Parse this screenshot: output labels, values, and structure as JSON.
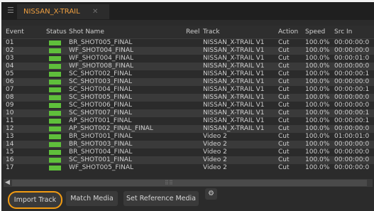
{
  "tab": {
    "title": "NISSAN_X-TRAIL",
    "close": "✕",
    "menu": "☰"
  },
  "columns": [
    "Event",
    "Status",
    "Shot Name",
    "Reel",
    "Track",
    "Action",
    "Speed",
    "Src In"
  ],
  "rows": [
    {
      "event": "01",
      "shot": "BR_SHOT005_FINAL",
      "reel": "",
      "track": "NISSAN_X-TRAIL V1",
      "action": "Cut",
      "speed": "100.0%",
      "src_in": "00:00:00:0"
    },
    {
      "event": "02",
      "shot": "WF_SHOT004_FINAL",
      "reel": "",
      "track": "NISSAN_X-TRAIL V1",
      "action": "Cut",
      "speed": "100.0%",
      "src_in": "00:00:00:0"
    },
    {
      "event": "03",
      "shot": "WF_SHOT004_FINAL",
      "reel": "",
      "track": "NISSAN_X-TRAIL V1",
      "action": "Cut",
      "speed": "100.0%",
      "src_in": "00:00:01:0"
    },
    {
      "event": "04",
      "shot": "WF_SHOT008_FINAL",
      "reel": "",
      "track": "NISSAN_X-TRAIL V1",
      "action": "Cut",
      "speed": "100.0%",
      "src_in": "00:00:00:0"
    },
    {
      "event": "05",
      "shot": "SC_SHOT002_FINAL",
      "reel": "",
      "track": "NISSAN_X-TRAIL V1",
      "action": "Cut",
      "speed": "100.0%",
      "src_in": "00:00:00:1"
    },
    {
      "event": "06",
      "shot": "SC_SHOT003_FINAL",
      "reel": "",
      "track": "NISSAN_X-TRAIL V1",
      "action": "Cut",
      "speed": "100.0%",
      "src_in": "00:00:00:0"
    },
    {
      "event": "07",
      "shot": "SC_SHOT004_FINAL",
      "reel": "",
      "track": "NISSAN_X-TRAIL V1",
      "action": "Cut",
      "speed": "100.0%",
      "src_in": "00:00:00:1"
    },
    {
      "event": "08",
      "shot": "SC_SHOT005_FINAL",
      "reel": "",
      "track": "NISSAN_X-TRAIL V1",
      "action": "Cut",
      "speed": "100.0%",
      "src_in": "00:00:00:0"
    },
    {
      "event": "09",
      "shot": "SC_SHOT006_FINAL",
      "reel": "",
      "track": "NISSAN_X-TRAIL V1",
      "action": "Cut",
      "speed": "100.0%",
      "src_in": "00:00:00:0"
    },
    {
      "event": "10",
      "shot": "SC_SHOT007_FINAL",
      "reel": "",
      "track": "NISSAN_X-TRAIL V1",
      "action": "Cut",
      "speed": "100.0%",
      "src_in": "00:00:00:1"
    },
    {
      "event": "11",
      "shot": "AP_SHOT001_FINAL",
      "reel": "",
      "track": "NISSAN_X-TRAIL V1",
      "action": "Cut",
      "speed": "100.0%",
      "src_in": "00:00:00:1"
    },
    {
      "event": "12",
      "shot": "AP_SHOT002_FINAL_FINAL",
      "reel": "",
      "track": "NISSAN_X-TRAIL V1",
      "action": "Cut",
      "speed": "100.0%",
      "src_in": "00:00:00:0"
    },
    {
      "event": "13",
      "shot": "BR_SHOT001_FINAL",
      "reel": "",
      "track": "Video 2",
      "action": "Cut",
      "speed": "100.0%",
      "src_in": "01:00:01:0"
    },
    {
      "event": "14",
      "shot": "BR_SHOT003_FINAL",
      "reel": "",
      "track": "Video 2",
      "action": "Cut",
      "speed": "100.0%",
      "src_in": "00:00:00:0"
    },
    {
      "event": "15",
      "shot": "BR_SHOT004_FINAL",
      "reel": "",
      "track": "Video 2",
      "action": "Cut",
      "speed": "100.0%",
      "src_in": "00:00:00:0"
    },
    {
      "event": "16",
      "shot": "SC_SHOT001_FINAL",
      "reel": "",
      "track": "Video 2",
      "action": "Cut",
      "speed": "100.0%",
      "src_in": "00:00:00:0"
    },
    {
      "event": "17",
      "shot": "WF_SHOT005_FINAL",
      "reel": "",
      "track": "Video 2",
      "action": "Cut",
      "speed": "100.0%",
      "src_in": "00:00:00:0"
    }
  ],
  "scrollbar": {
    "arrow": "◀",
    "grip": "⠿⠿"
  },
  "buttons": {
    "import": "Import Track",
    "match": "Match Media",
    "set_ref": "Set Reference Media",
    "gear": "⚙"
  },
  "colors": {
    "accent": "#f39c12",
    "status_ok": "#5fbf3b",
    "tab_text": "#f0a040"
  }
}
